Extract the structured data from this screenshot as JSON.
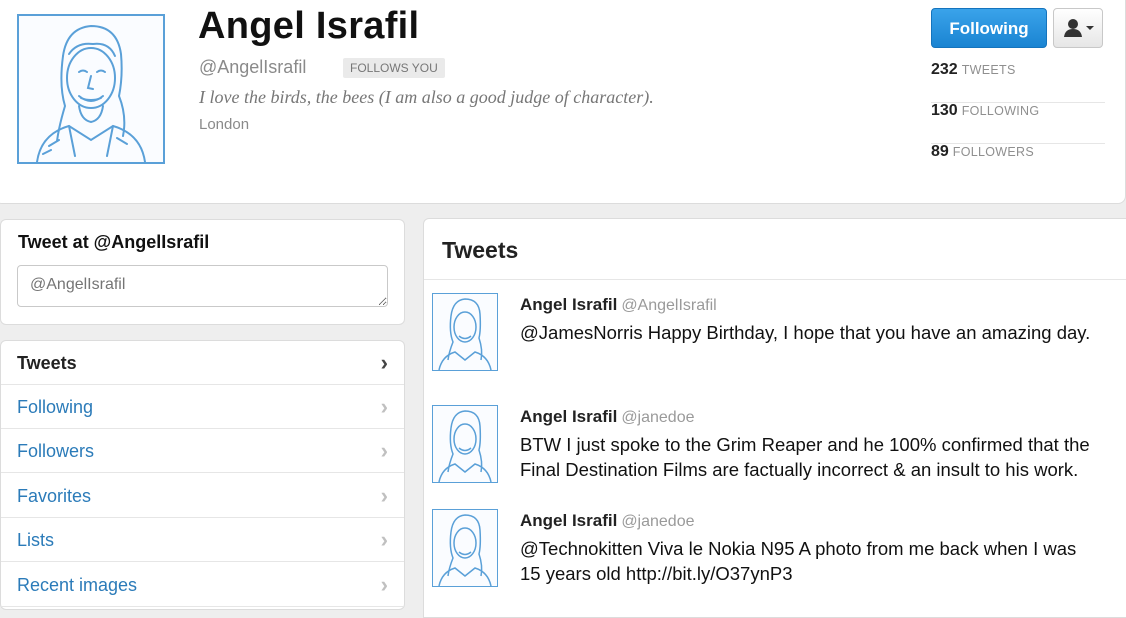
{
  "profile": {
    "name": "Angel Israfil",
    "handle": "@AngelIsrafil",
    "follows_badge": "FOLLOWS YOU",
    "bio": "I love the birds, the bees (I am also a good judge of character).",
    "location": "London",
    "following_button": "Following",
    "stats": [
      {
        "num": "232",
        "label": "TWEETS"
      },
      {
        "num": "130",
        "label": "FOLLOWING"
      },
      {
        "num": "89",
        "label": "FOLLOWERS"
      }
    ]
  },
  "tweet_at": {
    "title": "Tweet at @AngelIsrafil",
    "placeholder": "@AngelIsrafil"
  },
  "nav": {
    "items": [
      {
        "label": "Tweets"
      },
      {
        "label": "Following"
      },
      {
        "label": "Followers"
      },
      {
        "label": "Favorites"
      },
      {
        "label": "Lists"
      },
      {
        "label": "Recent images"
      }
    ],
    "chevron": "›"
  },
  "stream": {
    "title": "Tweets",
    "tweets": [
      {
        "name": "Angel Israfil",
        "handle": "@AngelIsrafil",
        "text": "@JamesNorris Happy Birthday, I hope that you have an amazing day."
      },
      {
        "name": "Angel Israfil",
        "handle": "@janedoe",
        "text": "BTW I just spoke to the Grim Reaper and he 100% confirmed that the Final Destination Films are factually incorrect & an insult to his work."
      },
      {
        "name": "Angel Israfil",
        "handle": "@janedoe",
        "text": "@Technokitten Viva le Nokia N95 A photo from me back when I was 15 years old http://bit.ly/O37ynP3"
      }
    ]
  },
  "colors": {
    "accent": "#1a84d2",
    "link": "#2b7bb9",
    "avatar_line": "#5aa0d8"
  }
}
